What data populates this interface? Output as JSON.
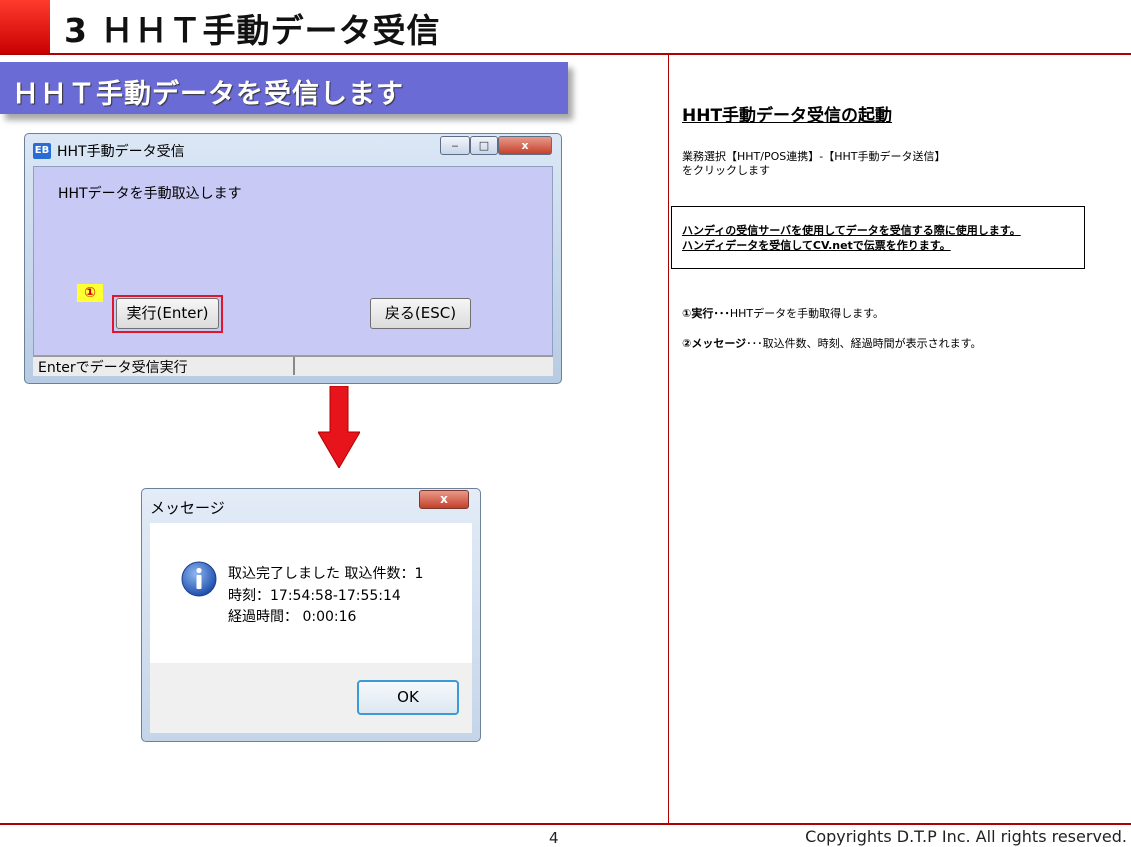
{
  "header": {
    "title": "3 ＨＨＴ手動データ受信"
  },
  "banner": {
    "text": "ＨＨＴ手動データを受信します"
  },
  "window1": {
    "title": "HHT手動データ受信",
    "app_icon": "EB",
    "title_buttons": {
      "minimize": "‒",
      "maximize": "□",
      "close": "x"
    },
    "message": "HHTデータを手動取込します",
    "marker": "①",
    "execute_button": "実行(Enter)",
    "back_button": "戻る(ESC)",
    "status": "Enterでデータ受信実行"
  },
  "arrow": {
    "color": "#e8141c",
    "icon": "down-arrow"
  },
  "message_box": {
    "title": "メッセージ",
    "close": "x",
    "icon": "info-icon",
    "line1": "取込完了しました 取込件数：1",
    "line2": "時刻：17:54:58-17:55:14",
    "line3": "経過時間： 0:00:16",
    "ok_button": "OK"
  },
  "right": {
    "heading": "HHT手動データ受信の起動",
    "operation_line1": "業務選択【HHT/POS連携】-【HHT手動データ送信】",
    "operation_line2": "をクリックします",
    "note_line1": "ハンディの受信サーバを使用してデータを受信する際に使用します。",
    "note_line2": "ハンディデータを受信してCV.netで伝票を作ります。",
    "desc1_label": "①実行･･･",
    "desc1_text": "HHTデータを手動取得します。",
    "desc2_label": "②メッセージ",
    "desc2_text": "･･･取込件数、時刻、経過時間が表示されます。"
  },
  "footer": {
    "page": "4",
    "copyright": "Copyrights D.T.P Inc. All rights reserved."
  },
  "colors": {
    "accent": "#b00000",
    "banner": "#6b6bd6",
    "window_client": "#c9c9f5",
    "highlight": "#ffff33"
  }
}
